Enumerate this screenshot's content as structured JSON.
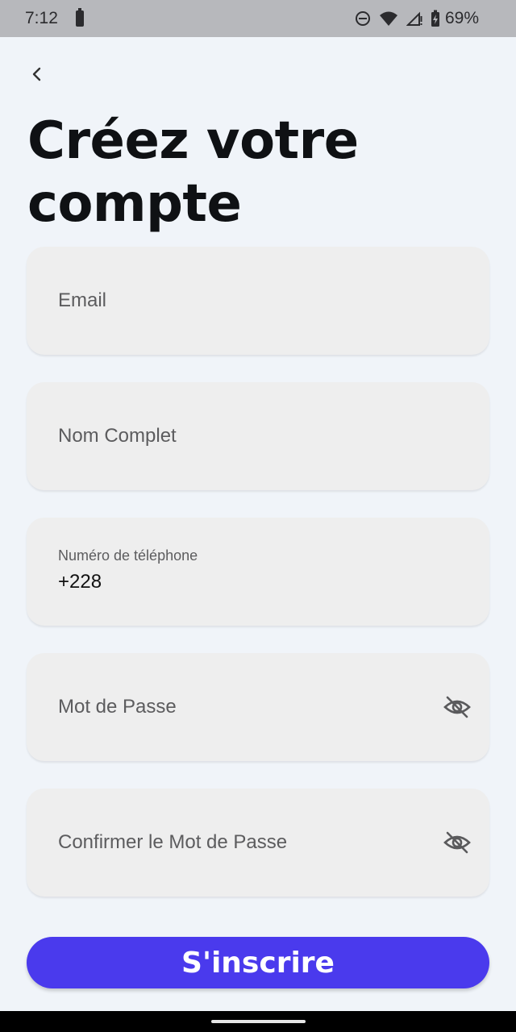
{
  "status_bar": {
    "time": "7:12",
    "battery_percent": "69%"
  },
  "page": {
    "title": "Créez votre compte"
  },
  "form": {
    "email": {
      "placeholder": "Email",
      "value": ""
    },
    "full_name": {
      "placeholder": "Nom Complet",
      "value": ""
    },
    "phone": {
      "label": "Numéro de téléphone",
      "value": "+228"
    },
    "password": {
      "placeholder": "Mot de Passe",
      "value": ""
    },
    "confirm_password": {
      "placeholder": "Confirmer le Mot de Passe",
      "value": ""
    }
  },
  "actions": {
    "submit_label": "S'inscrire"
  },
  "colors": {
    "accent": "#4a3aed",
    "background": "#f0f4f9",
    "field_bg": "#eeeeee"
  }
}
